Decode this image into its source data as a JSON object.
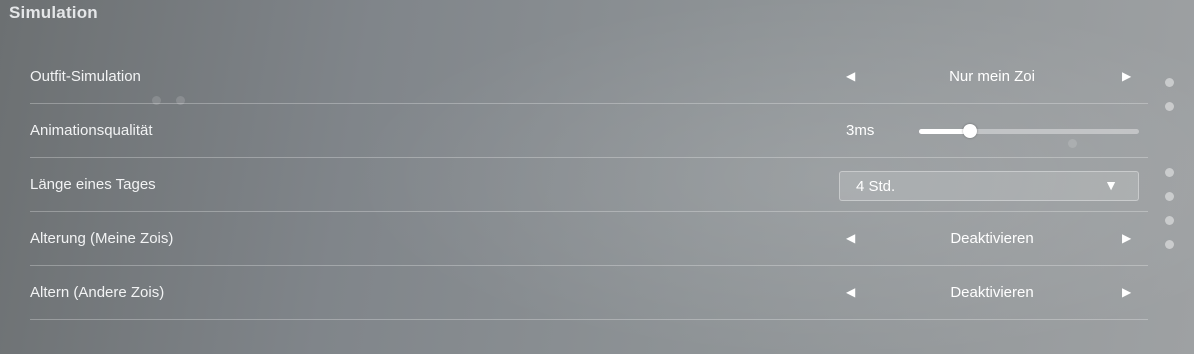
{
  "section": {
    "title": "Simulation"
  },
  "settings": [
    {
      "label": "Outfit-Simulation",
      "control": "cycle",
      "value": "Nur mein Zoi"
    },
    {
      "label": "Animationsqualität",
      "control": "slider",
      "value": "3ms",
      "level": 0.23
    },
    {
      "label": "Länge eines Tages",
      "control": "dropdown",
      "value": "4 Std."
    },
    {
      "label": "Alterung (Meine Zois)",
      "control": "cycle",
      "value": "Deaktivieren"
    },
    {
      "label": "Altern (Andere Zois)",
      "control": "cycle",
      "value": "Deaktivieren"
    }
  ],
  "icons": {
    "prev": "◀",
    "next": "▶",
    "dropdown": "▼"
  }
}
